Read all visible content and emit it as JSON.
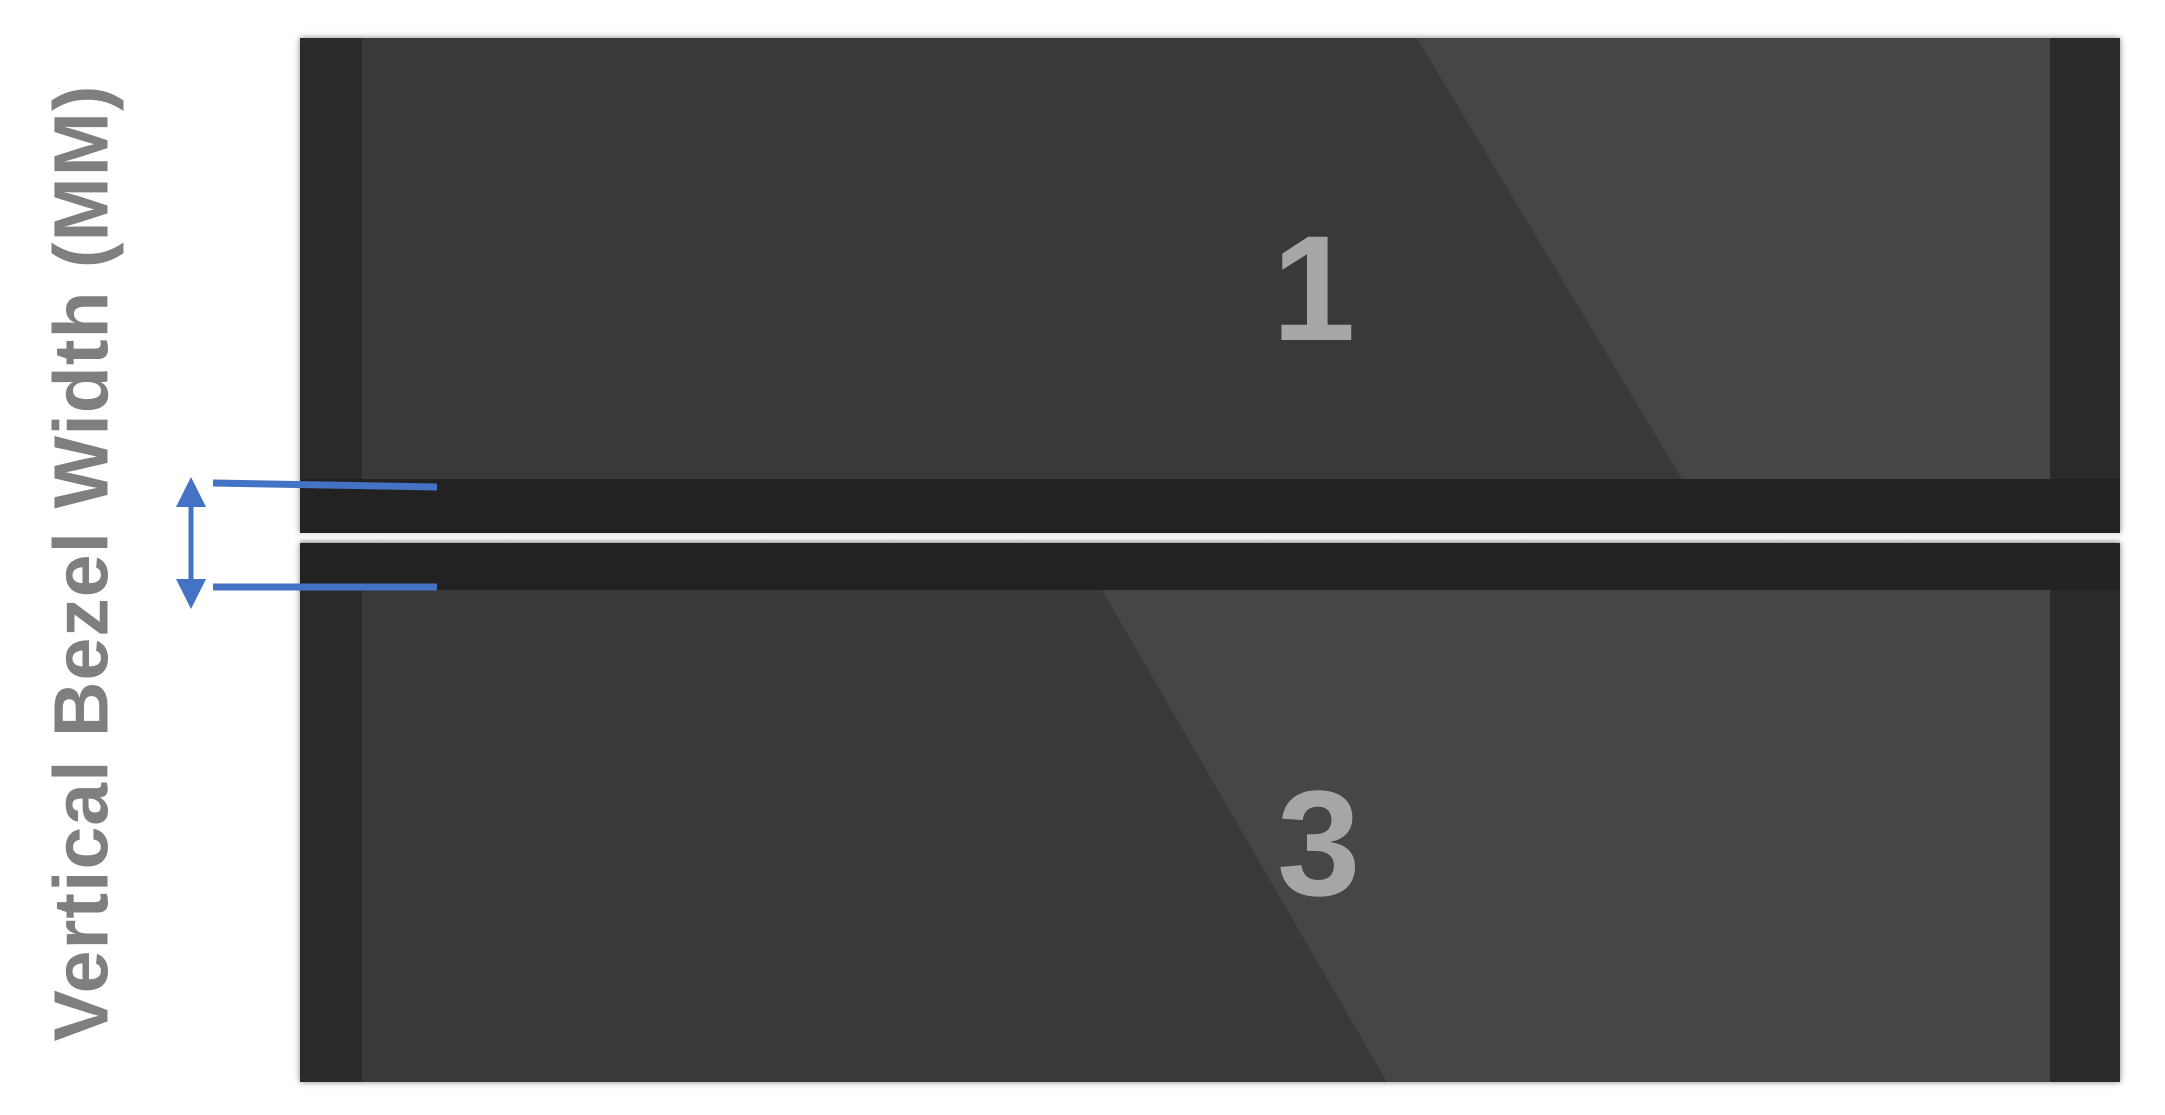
{
  "axis_label": "Vertical Bezel Width (MM)",
  "monitors": [
    {
      "number": "1"
    },
    {
      "number": "3"
    }
  ],
  "colors": {
    "label_gray": "#7f7f7f",
    "number_gray": "#a6a6a6",
    "bezel": "#222222",
    "screen": "#393939",
    "annotation_blue": "#4472c4"
  },
  "icons": {
    "measure_arrow": "double-headed-vertical-arrow-icon"
  }
}
